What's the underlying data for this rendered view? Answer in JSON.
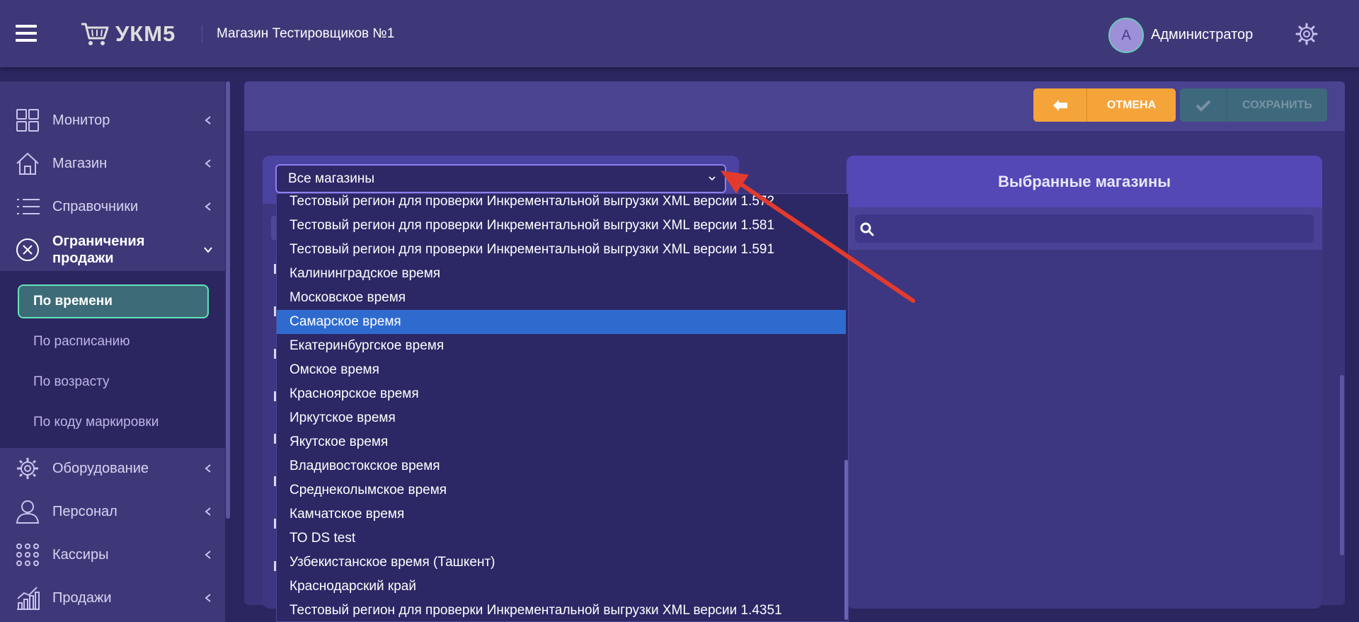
{
  "header": {
    "logo_text": "УКМ5",
    "store_name": "Магазин Тестировщиков №1",
    "avatar_letter": "А",
    "username": "Администратор"
  },
  "sidebar": {
    "items": [
      {
        "label": "Монитор",
        "icon": "grid-icon"
      },
      {
        "label": "Магазин",
        "icon": "house-icon"
      },
      {
        "label": "Справочники",
        "icon": "list-icon"
      },
      {
        "label": "Ограничения\nпродажи",
        "icon": "circle-x-icon",
        "expanded": true
      },
      {
        "label": "Оборудование",
        "icon": "gear-icon"
      },
      {
        "label": "Персонал",
        "icon": "user-icon"
      },
      {
        "label": "Кассиры",
        "icon": "dots-grid-icon"
      },
      {
        "label": "Продажи",
        "icon": "chart-icon"
      }
    ],
    "submenu": [
      {
        "label": "По времени",
        "active": true
      },
      {
        "label": "По расписанию"
      },
      {
        "label": "По возрасту"
      },
      {
        "label": "По коду маркировки"
      }
    ]
  },
  "toolbar": {
    "cancel_label": "ОТМЕНА",
    "save_label": "СОХРАНИТЬ"
  },
  "filter": {
    "selected": "Все магазины",
    "options": [
      "Тестовый регион для проверки Инкрементальной выгрузки XML версии 1.572",
      "Тестовый регион для проверки Инкрементальной выгрузки XML версии 1.581",
      "Тестовый регион для проверки Инкрементальной выгрузки XML версии 1.591",
      "Калининградское время",
      "Московское время",
      "Самарское время",
      "Екатеринбургское время",
      "Омское время",
      "Красноярское время",
      "Иркутское время",
      "Якутское время",
      "Владивостокское время",
      "Среднеколымское время",
      "Камчатское время",
      "ТО DS test",
      "Узбекистанское время (Ташкент)",
      "Краснодарский край",
      "Тестовый регион для проверки Инкрементальной выгрузки XML версии 1.4351"
    ],
    "highlighted": "Самарское время"
  },
  "right_panel": {
    "title": "Выбранные магазины",
    "search_placeholder": ""
  },
  "colors": {
    "cancel": "#f5a43a",
    "save": "#3d6e7a",
    "highlight": "#2f6bcf",
    "active_border": "#5fe3b5",
    "annotation_arrow": "#e23b2e"
  }
}
